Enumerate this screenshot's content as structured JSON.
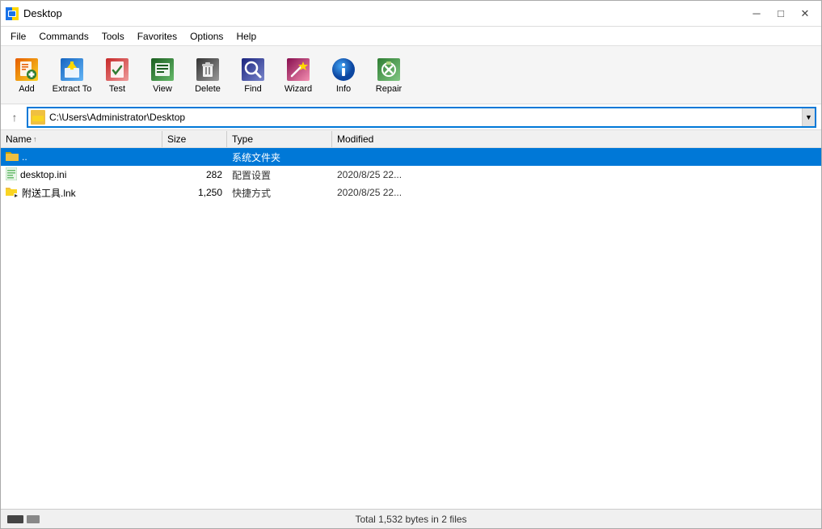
{
  "window": {
    "title": "Desktop",
    "icon": "winrar-icon"
  },
  "titlebar": {
    "title": "Desktop",
    "minimize_label": "─",
    "maximize_label": "□",
    "close_label": "✕"
  },
  "menubar": {
    "items": [
      {
        "id": "file",
        "label": "File"
      },
      {
        "id": "commands",
        "label": "Commands"
      },
      {
        "id": "tools",
        "label": "Tools"
      },
      {
        "id": "favorites",
        "label": "Favorites"
      },
      {
        "id": "options",
        "label": "Options"
      },
      {
        "id": "help",
        "label": "Help"
      }
    ]
  },
  "toolbar": {
    "buttons": [
      {
        "id": "add",
        "label": "Add",
        "icon": "add-icon"
      },
      {
        "id": "extract-to",
        "label": "Extract To",
        "icon": "extract-icon"
      },
      {
        "id": "test",
        "label": "Test",
        "icon": "test-icon"
      },
      {
        "id": "view",
        "label": "View",
        "icon": "view-icon"
      },
      {
        "id": "delete",
        "label": "Delete",
        "icon": "delete-icon"
      },
      {
        "id": "find",
        "label": "Find",
        "icon": "find-icon"
      },
      {
        "id": "wizard",
        "label": "Wizard",
        "icon": "wizard-icon"
      },
      {
        "id": "info",
        "label": "Info",
        "icon": "info-icon"
      },
      {
        "id": "repair",
        "label": "Repair",
        "icon": "repair-icon"
      }
    ]
  },
  "addressbar": {
    "up_button": "↑",
    "path": "C:\\Users\\Administrator\\Desktop",
    "dropdown_icon": "▼"
  },
  "filelist": {
    "columns": [
      {
        "id": "name",
        "label": "Name",
        "sort_indicator": "↑"
      },
      {
        "id": "size",
        "label": "Size"
      },
      {
        "id": "type",
        "label": "Type"
      },
      {
        "id": "modified",
        "label": "Modified"
      }
    ],
    "rows": [
      {
        "id": "parent",
        "name": "..",
        "size": "",
        "type": "系统文件夹",
        "modified": "",
        "selected": true,
        "icon": "folder-up-icon"
      },
      {
        "id": "desktop-ini",
        "name": "desktop.ini",
        "size": "282",
        "type": "配置设置",
        "modified": "2020/8/25 22...",
        "selected": false,
        "icon": "ini-file-icon"
      },
      {
        "id": "fj-tools",
        "name": "附送工具.lnk",
        "size": "1,250",
        "type": "快捷方式",
        "modified": "2020/8/25 22...",
        "selected": false,
        "icon": "lnk-file-icon"
      }
    ]
  },
  "statusbar": {
    "text": "Total 1,532 bytes in 2 files",
    "left_icons": [
      "drive-icon",
      "network-icon"
    ]
  }
}
